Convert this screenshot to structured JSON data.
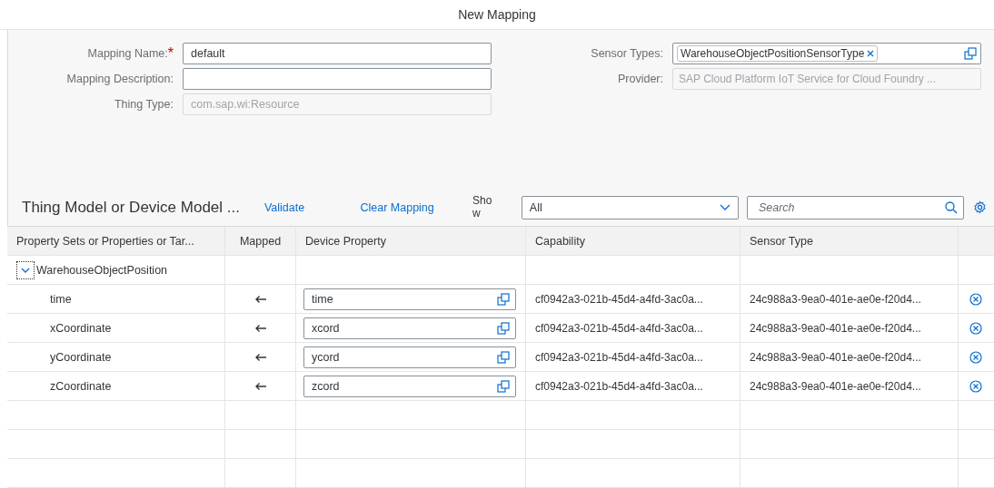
{
  "title": "New Mapping",
  "form_left": [
    {
      "label": "Mapping Name:",
      "required_mark": "*",
      "value": "default",
      "disabled": false
    },
    {
      "label": "Mapping Description:",
      "disabled": false
    },
    {
      "label": "Thing Type:",
      "value": "com.sap.wi:Resource",
      "disabled": true
    }
  ],
  "sensor_types": {
    "label": "Sensor Types:",
    "tokens": [
      "WarehouseObjectPositionSensorType"
    ]
  },
  "provider": {
    "label": "Provider:",
    "value": "SAP Cloud Platform IoT Service for Cloud Foundry ...",
    "disabled": true
  },
  "toolbar": {
    "title": "Thing Model or Device Model ...",
    "links": [
      "Validate",
      "Clear Mapping"
    ],
    "show_label": "Show",
    "show_value": "All",
    "search_placeholder": "Search"
  },
  "table": {
    "columns": [
      "Property Sets or Properties or Tar...",
      "Mapped",
      "Device Property",
      "Capability",
      "Sensor Type"
    ],
    "groups": [
      {
        "name": "WarehouseObjectPosition",
        "expanded": true,
        "children": [
          {
            "property": "time",
            "mapped": true,
            "device_property": "time",
            "capability": "cf0942a3-021b-45d4-a4fd-3ac0a...",
            "sensor_type": "24c988a3-9ea0-401e-ae0e-f20d4..."
          },
          {
            "property": "xCoordinate",
            "mapped": true,
            "device_property": "xcord",
            "capability": "cf0942a3-021b-45d4-a4fd-3ac0a...",
            "sensor_type": "24c988a3-9ea0-401e-ae0e-f20d4..."
          },
          {
            "property": "yCoordinate",
            "mapped": true,
            "device_property": "ycord",
            "capability": "cf0942a3-021b-45d4-a4fd-3ac0a...",
            "sensor_type": "24c988a3-9ea0-401e-ae0e-f20d4..."
          },
          {
            "property": "zCoordinate",
            "mapped": true,
            "device_property": "zcord",
            "capability": "cf0942a3-021b-45d4-a4fd-3ac0a...",
            "sensor_type": "24c988a3-9ea0-401e-ae0e-f20d4..."
          }
        ]
      }
    ]
  }
}
